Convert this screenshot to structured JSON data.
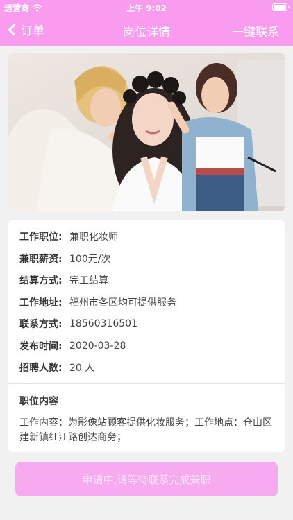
{
  "status_bar": {
    "carrier": "运营商",
    "time": "上午 9:02"
  },
  "nav": {
    "back_label": "订单",
    "title": "岗位详情",
    "contact_label": "一键联系"
  },
  "photo": {
    "alt": "makeup-artists-at-work"
  },
  "details": [
    {
      "label": "工作职位:",
      "value": "兼职化妆师"
    },
    {
      "label": "兼职薪资:",
      "value": "100元/次"
    },
    {
      "label": "结算方式:",
      "value": "完工结算"
    },
    {
      "label": "工作地址:",
      "value": "福州市各区均可提供服务"
    },
    {
      "label": "联系方式:",
      "value": "18560316501"
    },
    {
      "label": "发布时间:",
      "value": "2020-03-28"
    },
    {
      "label": "招聘人数:",
      "value": "20 人"
    }
  ],
  "content": {
    "title": "职位内容",
    "body": "工作内容：为影像站顾客提供化妆服务；工作地点：仓山区建新镇红江路创达商务；"
  },
  "apply_button": {
    "label": "申请中,请等待联系完成兼职"
  },
  "colors": {
    "brand_pink": "#f99bef",
    "button_pink": "#f7aaef",
    "background": "#f1f1f1"
  }
}
